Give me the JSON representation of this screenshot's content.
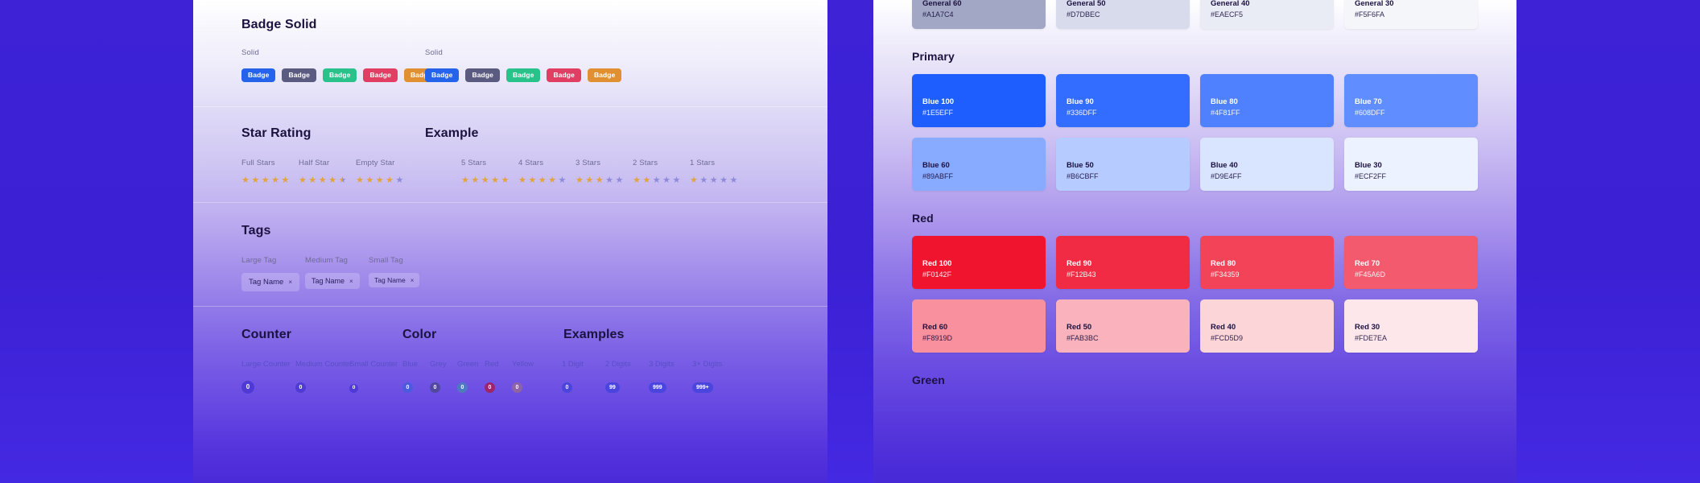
{
  "left_panel": {
    "badge_section": {
      "title": "Badge Solid",
      "groups": [
        {
          "label": "Solid",
          "badges": [
            {
              "text": "Badge",
              "color": "#2563EB"
            },
            {
              "text": "Badge",
              "color": "#5B5A80"
            },
            {
              "text": "Badge",
              "color": "#28C28A"
            },
            {
              "text": "Badge",
              "color": "#E03E63"
            },
            {
              "text": "Badge",
              "color": "#E09030"
            }
          ]
        },
        {
          "label": "Solid",
          "badges": [
            {
              "text": "Badge",
              "color": "#2563EB"
            },
            {
              "text": "Badge",
              "color": "#5B5A80"
            },
            {
              "text": "Badge",
              "color": "#28C28A"
            },
            {
              "text": "Badge",
              "color": "#E03E63"
            },
            {
              "text": "Badge",
              "color": "#E09030"
            }
          ]
        }
      ]
    },
    "star_section": {
      "title": "Star Rating",
      "example_title": "Example",
      "types": [
        {
          "label": "Full Stars",
          "full": 5,
          "half": 0,
          "empty": 0
        },
        {
          "label": "Half Star",
          "full": 4,
          "half": 1,
          "empty": 0
        },
        {
          "label": "Empty Star",
          "full": 4,
          "half": 0,
          "empty": 1
        }
      ],
      "examples": [
        {
          "label": "5 Stars",
          "full": 5,
          "half": 0,
          "empty": 0
        },
        {
          "label": "4 Stars",
          "full": 4,
          "half": 0,
          "empty": 1
        },
        {
          "label": "3 Stars",
          "full": 3,
          "half": 0,
          "empty": 2
        },
        {
          "label": "2 Stars",
          "full": 2,
          "half": 0,
          "empty": 3
        },
        {
          "label": "1 Stars",
          "full": 1,
          "half": 0,
          "empty": 4
        }
      ]
    },
    "tag_section": {
      "title": "Tags",
      "items": [
        {
          "label": "Large Tag",
          "text": "Tag Name",
          "size": "lg"
        },
        {
          "label": "Medium Tag",
          "text": "Tag Name",
          "size": "md"
        },
        {
          "label": "Small Tag",
          "text": "Tag Name",
          "size": "sm"
        }
      ],
      "close_icon": "×"
    },
    "counter_section": {
      "title": "Counter",
      "color_title": "Color",
      "examples_title": "Examples",
      "sizes": [
        {
          "label": "Large Counter",
          "value": "0",
          "size": 16,
          "font": 8,
          "color": "#4F3AD6"
        },
        {
          "label": "Medium Counter",
          "value": "0",
          "size": 13,
          "font": 7,
          "color": "#4F3AD6"
        },
        {
          "label": "Small Counter",
          "value": "0",
          "size": 11,
          "font": 6.5,
          "color": "#4F3AD6"
        }
      ],
      "colors": [
        {
          "label": "Blue",
          "value": "0",
          "color": "#4A5BE0"
        },
        {
          "label": "Grey",
          "value": "0",
          "color": "#52489E"
        },
        {
          "label": "Green",
          "value": "0",
          "color": "#4E7AC4"
        },
        {
          "label": "Red",
          "value": "0",
          "color": "#A0246B"
        },
        {
          "label": "Yellow",
          "value": "0",
          "color": "#8E63A8"
        }
      ],
      "examples": [
        {
          "label": "1 Digit",
          "value": "0",
          "color": "#4A45DE"
        },
        {
          "label": "2 Digits",
          "value": "99",
          "color": "#4A45DE"
        },
        {
          "label": "3 Digits",
          "value": "999",
          "color": "#4A45DE"
        },
        {
          "label": "3+ Digits",
          "value": "999+",
          "color": "#4A45DE"
        }
      ]
    }
  },
  "right_panel": {
    "general_row": [
      {
        "name": "General 60",
        "hex": "#A1A7C4",
        "bg": "#A1A7C4",
        "fg": "#1c1240"
      },
      {
        "name": "General 50",
        "hex": "#D7DBEC",
        "bg": "#D7DBEC",
        "fg": "#1c1240"
      },
      {
        "name": "General 40",
        "hex": "#EAECF5",
        "bg": "#EAECF5",
        "fg": "#1c1240"
      },
      {
        "name": "General 30",
        "hex": "#F5F6FA",
        "bg": "#F5F6FA",
        "fg": "#1c1240"
      }
    ],
    "primary": {
      "title": "Primary",
      "rows": [
        [
          {
            "name": "Blue 100",
            "hex": "#1E5EFF",
            "bg": "#1E5EFF",
            "fg": "#ffffff"
          },
          {
            "name": "Blue 90",
            "hex": "#336DFF",
            "bg": "#336DFF",
            "fg": "#ffffff"
          },
          {
            "name": "Blue 80",
            "hex": "#4F81FF",
            "bg": "#4F81FF",
            "fg": "#ffffff"
          },
          {
            "name": "Blue 70",
            "hex": "#608DFF",
            "bg": "#608DFF",
            "fg": "#ffffff"
          }
        ],
        [
          {
            "name": "Blue 60",
            "hex": "#89ABFF",
            "bg": "#89ABFF",
            "fg": "#1c1240"
          },
          {
            "name": "Blue 50",
            "hex": "#B6CBFF",
            "bg": "#B6CBFF",
            "fg": "#1c1240"
          },
          {
            "name": "Blue 40",
            "hex": "#D9E4FF",
            "bg": "#D9E4FF",
            "fg": "#1c1240"
          },
          {
            "name": "Blue 30",
            "hex": "#ECF2FF",
            "bg": "#ECF2FF",
            "fg": "#1c1240"
          }
        ]
      ]
    },
    "red": {
      "title": "Red",
      "rows": [
        [
          {
            "name": "Red 100",
            "hex": "#F0142F",
            "bg": "#F0142F",
            "fg": "#ffffff"
          },
          {
            "name": "Red 90",
            "hex": "#F12B43",
            "bg": "#F12B43",
            "fg": "#ffffff"
          },
          {
            "name": "Red 80",
            "hex": "#F34359",
            "bg": "#F34359",
            "fg": "#ffffff"
          },
          {
            "name": "Red 70",
            "hex": "#F45A6D",
            "bg": "#F45A6D",
            "fg": "#ffffff"
          }
        ],
        [
          {
            "name": "Red 60",
            "hex": "#F8919D",
            "bg": "#F8919D",
            "fg": "#1c1240"
          },
          {
            "name": "Red 50",
            "hex": "#FAB3BC",
            "bg": "#FAB3BC",
            "fg": "#1c1240"
          },
          {
            "name": "Red 40",
            "hex": "#FCD5D9",
            "bg": "#FCD5D9",
            "fg": "#1c1240"
          },
          {
            "name": "Red 30",
            "hex": "#FDE7EA",
            "bg": "#FDE7EA",
            "fg": "#1c1240"
          }
        ]
      ]
    },
    "green": {
      "title": "Green"
    }
  }
}
